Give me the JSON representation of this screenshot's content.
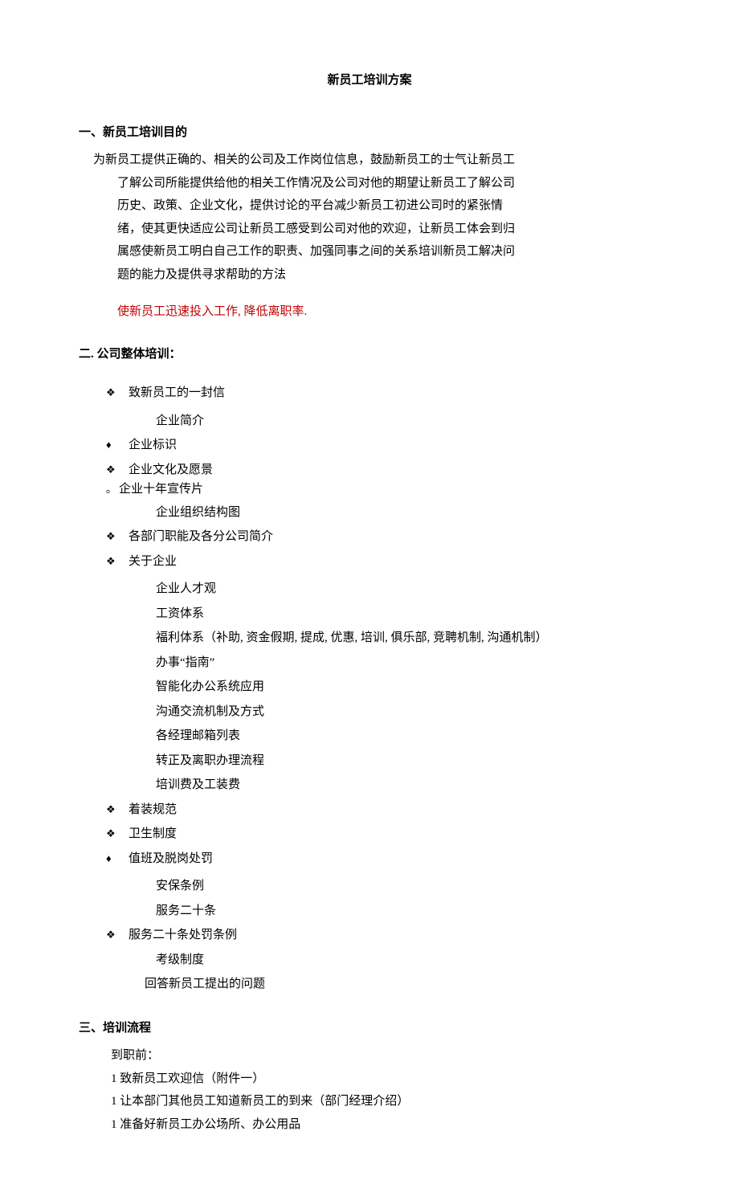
{
  "title": "新员工培训方案",
  "section1": {
    "heading": "一、新员工培训目的",
    "body_first": "为新员工提供正确的、相关的公司及工作岗位信息，鼓励新员工的士气让新员工",
    "body_rest": [
      "了解公司所能提供给他的相关工作情况及公司对他的期望让新员工了解公司",
      "历史、政策、企业文化，提供讨论的平台减少新员工初进公司时的紧张情",
      "绪，使其更快适应公司让新员工感受到公司对他的欢迎，让新员工体会到归",
      "属感使新员工明白自己工作的职责、加强同事之间的关系培训新员工解决问",
      "题的能力及提供寻求帮助的方法"
    ],
    "highlight": "使新员工迅速投入工作, 降低离职率."
  },
  "section2": {
    "heading": "二. 公司整体培训：",
    "items": [
      {
        "mark": "❖",
        "text": "致新员工的一封信"
      },
      {
        "sub": true,
        "text": "企业简介"
      },
      {
        "mark": "♦",
        "text": "企业标识"
      },
      {
        "mark": "❖",
        "text": "企业文化及愿景"
      },
      {
        "mark": "。",
        "text": "企业十年宣传片"
      },
      {
        "sub": true,
        "text": "企业组织结构图"
      },
      {
        "mark": "❖",
        "text": "各部门职能及各分公司简介"
      },
      {
        "mark": "❖",
        "text": "关于企业"
      },
      {
        "sub": true,
        "text": "企业人才观"
      },
      {
        "sub": true,
        "text": "工资体系"
      },
      {
        "sub": true,
        "text": "福利体系（补助, 资金假期, 提成, 优惠, 培训, 俱乐部, 竞聘机制, 沟通机制）"
      },
      {
        "sub": true,
        "text": "办事“指南”"
      },
      {
        "sub": true,
        "text": "智能化办公系统应用"
      },
      {
        "sub": true,
        "text": "沟通交流机制及方式"
      },
      {
        "sub": true,
        "text": "各经理邮箱列表"
      },
      {
        "sub": true,
        "text": "转正及离职办理流程"
      },
      {
        "sub": true,
        "text": "培训费及工装费"
      },
      {
        "mark": "❖",
        "text": "着装规范"
      },
      {
        "mark": "❖",
        "text": "卫生制度"
      },
      {
        "mark": "♦",
        "text": "值班及脱岗处罚"
      },
      {
        "sub": true,
        "text": "安保条例"
      },
      {
        "sub": true,
        "text": "服务二十条"
      },
      {
        "mark": "❖",
        "text": "服务二十条处罚条例"
      },
      {
        "sub": true,
        "text": "考级制度"
      },
      {
        "sub2": true,
        "text": "回答新员工提出的问题"
      }
    ]
  },
  "section3": {
    "heading": "三、培训流程",
    "lead": "到职前：",
    "items": [
      "1 致新员工欢迎信（附件一）",
      "1 让本部门其他员工知道新员工的到来（部门经理介绍）",
      "1 准备好新员工办公场所、办公用品"
    ]
  }
}
